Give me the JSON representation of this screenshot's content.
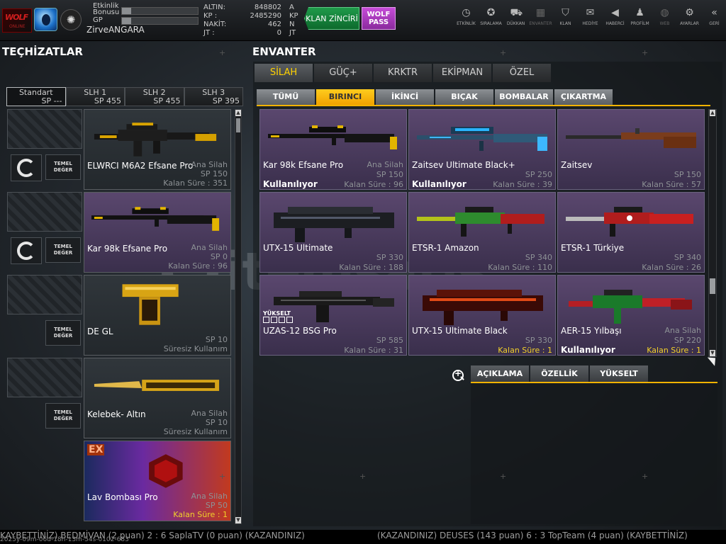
{
  "user": {
    "etkinlik_label": "Etkinlik Bonusu",
    "etkinlik_pct": 0.12,
    "gp_label": "GP",
    "gp_pct": 0.12,
    "name": "ZirveANGARA"
  },
  "currency": [
    {
      "label": "ALTIN:",
      "value": "848802",
      "unit": "A"
    },
    {
      "label": "KP :",
      "value": "2485290",
      "unit": "KP"
    },
    {
      "label": "NAKİT:",
      "value": "462",
      "unit": "N"
    },
    {
      "label": "JT :",
      "value": "0",
      "unit": "JT"
    }
  ],
  "promo": {
    "klan": "KLAN ZİNCİRİ",
    "wolf": "WOLF PASS"
  },
  "nav": [
    {
      "label": "ETKİNLİK",
      "icon": "clock-icon",
      "glyph": "◷",
      "dim": false
    },
    {
      "label": "SIRALAMA",
      "icon": "medal-icon",
      "glyph": "✪",
      "dim": false
    },
    {
      "label": "DÜKKAN",
      "icon": "cart-icon",
      "glyph": "⛟",
      "dim": false
    },
    {
      "label": "ENVANTER",
      "icon": "inventory-icon",
      "glyph": "▦",
      "dim": true
    },
    {
      "label": "KLAN",
      "icon": "shield-icon",
      "glyph": "⛉",
      "dim": false
    },
    {
      "label": "HEDİYE",
      "icon": "gift-icon",
      "glyph": "✉",
      "dim": false
    },
    {
      "label": "HABERCİ",
      "icon": "megaphone-icon",
      "glyph": "◀",
      "dim": false
    },
    {
      "label": "PROFİLM",
      "icon": "profile-icon",
      "glyph": "♟",
      "dim": false
    },
    {
      "label": "WEB",
      "icon": "globe-icon",
      "glyph": "◍",
      "dim": true
    },
    {
      "label": "AYARLAR",
      "icon": "gear-icon",
      "glyph": "⚙",
      "dim": false
    },
    {
      "label": "GERİ",
      "icon": "back-icon",
      "glyph": "«",
      "dim": false
    }
  ],
  "left": {
    "title": "TEÇHİZATLAR",
    "presets": [
      {
        "name": "Standart",
        "sp": "SP ---",
        "active": true
      },
      {
        "name": "SLH 1",
        "sp": "SP 455",
        "active": false
      },
      {
        "name": "SLH 2",
        "sp": "SP 455",
        "active": false
      },
      {
        "name": "SLH 3",
        "sp": "SP 395",
        "active": false
      }
    ],
    "temel": "TEMEL DEĞER",
    "cards": [
      {
        "name": "ELWRCI M6A2 Efsane Pro",
        "type": "Ana Silah",
        "sp": "SP 150",
        "ks": "Kalan Süre : 351",
        "yellow": false,
        "sel": false
      },
      {
        "name": "Kar 98k Efsane Pro",
        "type": "Ana Silah",
        "sp": "SP 0",
        "ks": "Kalan Süre : 96",
        "yellow": false,
        "sel": true
      },
      {
        "name": "DE GL",
        "type": "",
        "sp": "SP 10",
        "ks": "Süresiz Kullanım",
        "yellow": false,
        "sel": false
      },
      {
        "name": "Kelebek- Altın",
        "type": "Ana Silah",
        "sp": "SP 10",
        "ks": "Süresiz Kullanım",
        "yellow": false,
        "sel": false
      },
      {
        "name": "Lav Bombası Pro",
        "type": "Ana Silah",
        "sp": "SP 50",
        "ks": "Kalan Süre : 1",
        "yellow": true,
        "sel": false,
        "ex": "EX"
      }
    ]
  },
  "right": {
    "title": "ENVANTER",
    "tabs1": [
      {
        "label": "SİLAH",
        "active": true
      },
      {
        "label": "GÜÇ+",
        "active": false
      },
      {
        "label": "KRKTR",
        "active": false
      },
      {
        "label": "EKİPMAN",
        "active": false
      },
      {
        "label": "ÖZEL",
        "active": false
      }
    ],
    "tabs2": [
      {
        "label": "TÜMÜ",
        "active": false
      },
      {
        "label": "BIRINCI",
        "active": true
      },
      {
        "label": "İKİNCİ",
        "active": false
      },
      {
        "label": "BIÇAK",
        "active": false
      },
      {
        "label": "BOMBALAR",
        "active": false
      },
      {
        "label": "ÇIKARTMA",
        "active": false
      }
    ],
    "items": [
      {
        "name": "Kar 98k Efsane Pro",
        "type": "Ana Silah",
        "sp": "SP 150",
        "ks": "Kalan Süre : 96",
        "used": "Kullanılıyor",
        "yellow": false,
        "hl": true
      },
      {
        "name": "Zaitsev Ultimate Black+",
        "type": "",
        "sp": "SP 250",
        "ks": "Kalan Süre : 39",
        "used": "Kullanılıyor",
        "yellow": false,
        "hl": true
      },
      {
        "name": "Zaitsev",
        "type": "",
        "sp": "SP 150",
        "ks": "Kalan Süre : 57",
        "used": "",
        "yellow": false,
        "hl": true
      },
      {
        "name": "UTX-15 Ultimate",
        "type": "",
        "sp": "SP 330",
        "ks": "Kalan Süre : 188",
        "used": "",
        "yellow": false,
        "hl": true
      },
      {
        "name": "ETSR-1 Amazon",
        "type": "",
        "sp": "SP 340",
        "ks": "Kalan Süre : 110",
        "used": "",
        "yellow": false,
        "hl": true
      },
      {
        "name": "ETSR-1 Türkiye",
        "type": "",
        "sp": "SP 340",
        "ks": "Kalan Süre : 26",
        "used": "",
        "yellow": false,
        "hl": true
      },
      {
        "name": "UZAS-12 BSG Pro",
        "type": "",
        "sp": "SP 585",
        "ks": "Kalan Süre : 31",
        "used": "",
        "yellow": false,
        "hl": true,
        "yukselt": "YÜKSELT"
      },
      {
        "name": "UTX-15 Ultimate Black",
        "type": "",
        "sp": "SP 330",
        "ks": "Kalan Süre : 1",
        "used": "",
        "yellow": true,
        "hl": true
      },
      {
        "name": "AER-15 Yılbaşı",
        "type": "Ana Silah",
        "sp": "SP 220",
        "ks": "Kalan Süre : 1",
        "used": "Kullanılıyor",
        "yellow": true,
        "hl": true
      }
    ],
    "detail_tabs": [
      {
        "label": "AÇIKLAMA"
      },
      {
        "label": "ÖZELLİK"
      },
      {
        "label": "YÜKSELT"
      }
    ]
  },
  "ticker": {
    "left": "KAYBETTİNİZ) BEDMİVAN (2 puan) 2 : 6 SaplaTV (0 puan) (KAZANDINIZ)",
    "right": "(KAZANDINIZ) DEUSES (143 puan) 6 : 3 TopTeam (4 puan) (KAYBETTİNİZ)",
    "timestamp": "2025y-09m-06d-18h-13m-54s-0102-683"
  },
  "watermark": "itemsatış"
}
